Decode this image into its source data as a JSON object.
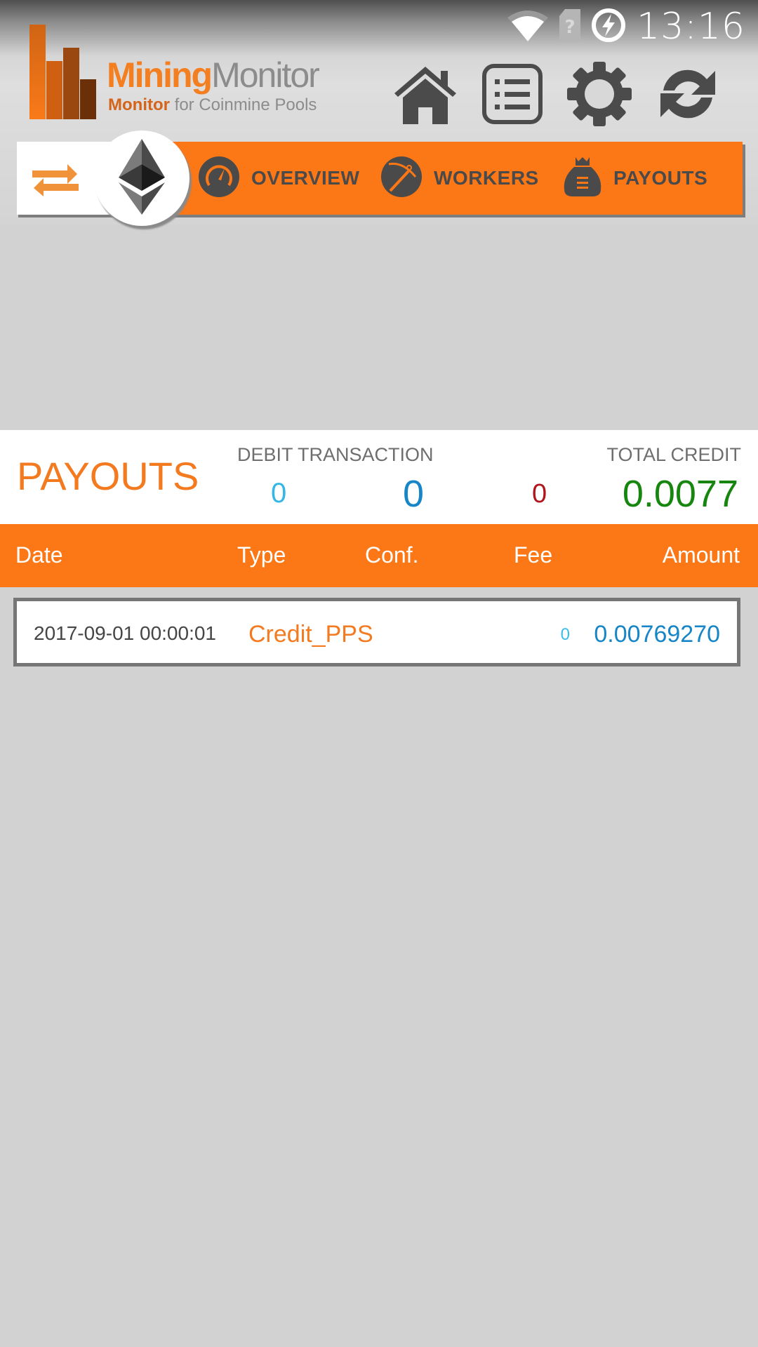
{
  "status_bar": {
    "time": "13:16",
    "icons": [
      "wifi-icon",
      "no-sim-icon",
      "battery-charging-icon"
    ]
  },
  "app": {
    "logo_title_part1": "Mining",
    "logo_title_part2": "Monitor",
    "logo_subtitle_part1": "Monitor",
    "logo_subtitle_part2": " for Coinmine Pools",
    "brand_color": "#fc7716"
  },
  "toolbar": {
    "icons": [
      "home-icon",
      "list-icon",
      "settings-gear-icon",
      "refresh-icon"
    ]
  },
  "nav": {
    "coin_icon": "ethereum-icon",
    "swap_icon": "swap-arrows-icon",
    "items": [
      {
        "label": "OVERVIEW",
        "icon": "speedometer-icon"
      },
      {
        "label": "WORKERS",
        "icon": "pickaxe-icon"
      },
      {
        "label": "PAYOUTS",
        "icon": "money-bag-icon"
      }
    ]
  },
  "summary": {
    "title": "PAYOUTS",
    "debit_label": "DEBIT TRANSACTION",
    "debit_small_value": "0",
    "debit_value": "0",
    "fee_value": "0",
    "credit_label": "TOTAL CREDIT",
    "credit_value": "0.0077"
  },
  "table": {
    "columns": [
      "Date",
      "Type",
      "Conf.",
      "Fee",
      "Amount"
    ],
    "rows": [
      {
        "date": "2017-09-01 00:00:01",
        "type": "Credit_PPS",
        "conf": "0",
        "fee": "",
        "amount": "0.00769270"
      }
    ]
  }
}
